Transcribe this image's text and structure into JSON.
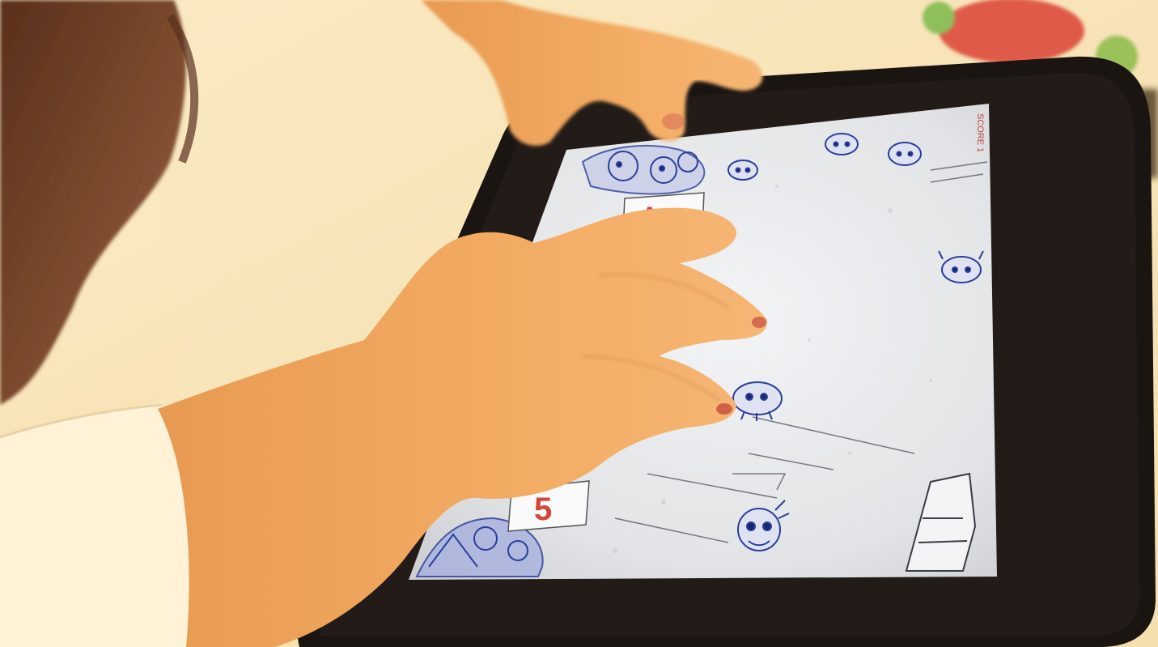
{
  "photo": {
    "description_labels": {
      "table": "table",
      "tablet": "tablet",
      "child-hand": "child-hand"
    }
  },
  "game": {
    "score_text": "SCORE 1",
    "counter_value": "5",
    "top_badge_text": "A"
  },
  "colors": {
    "table": "#f7e3b6",
    "tablet_case": "#1b1512",
    "screen_paper": "#e9ebee",
    "ink_blue": "#2a3f9a",
    "counter_red": "#d6453a",
    "skin": "#f0a860",
    "sleeve": "#fff2d6",
    "hair": "#7c4a2c"
  }
}
